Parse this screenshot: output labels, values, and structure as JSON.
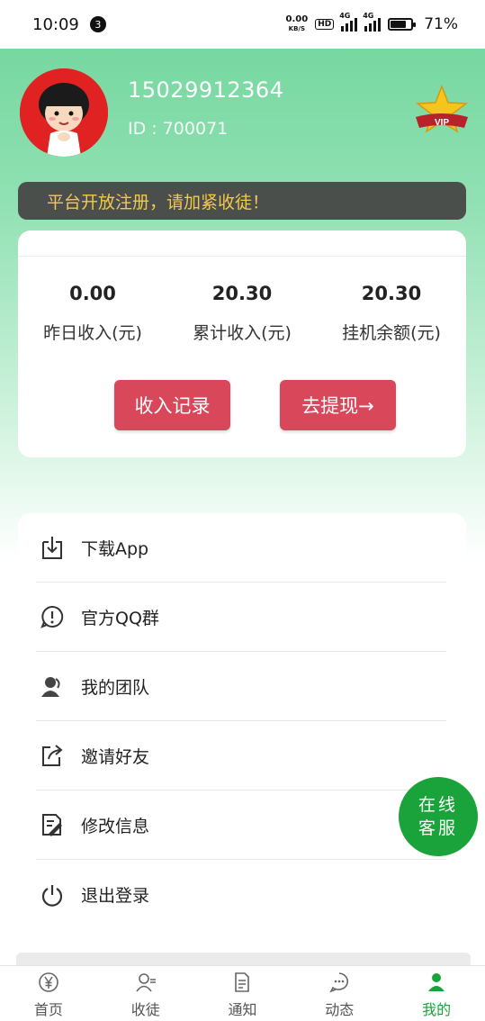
{
  "status_bar": {
    "time": "10:09",
    "notification_count": "3",
    "speed_value": "0.00",
    "speed_unit": "KB/S",
    "hd_label": "HD",
    "network_1": "4G",
    "network_2": "4G",
    "battery_percent": "71%",
    "battery_level": 0.71
  },
  "profile": {
    "phone": "15029912364",
    "id_text": "ID : 700071",
    "vip_label": "VIP"
  },
  "notice": {
    "text": "平台开放注册，请加紧收徒！"
  },
  "earnings": {
    "stats": [
      {
        "value": "0.00",
        "label": "昨日收入(元)"
      },
      {
        "value": "20.30",
        "label": "累计收入(元)"
      },
      {
        "value": "20.30",
        "label": "挂机余额(元)"
      }
    ],
    "income_record_button": "收入记录",
    "withdraw_button": "去提现→"
  },
  "menu": {
    "items": [
      {
        "label": "下载App",
        "icon": "download-icon"
      },
      {
        "label": "官方QQ群",
        "icon": "alert-circle-icon"
      },
      {
        "label": "我的团队",
        "icon": "team-icon"
      },
      {
        "label": "邀请好友",
        "icon": "share-icon"
      },
      {
        "label": "修改信息",
        "icon": "edit-document-icon"
      },
      {
        "label": "退出登录",
        "icon": "power-icon"
      }
    ]
  },
  "online_service": {
    "line1": "在线",
    "line2": "客服"
  },
  "tabbar": {
    "items": [
      {
        "label": "首页",
        "icon": "yuan-icon"
      },
      {
        "label": "收徒",
        "icon": "add-user-icon"
      },
      {
        "label": "通知",
        "icon": "document-icon"
      },
      {
        "label": "动态",
        "icon": "chat-icon"
      },
      {
        "label": "我的",
        "icon": "user-icon"
      }
    ],
    "active_index": 4
  },
  "colors": {
    "brand_green": "#1aa33b",
    "header_gradient_top": "#6fd59a",
    "button_red": "#d9485a",
    "notice_bg": "#4a4f4c",
    "notice_text": "#f4c94a"
  }
}
